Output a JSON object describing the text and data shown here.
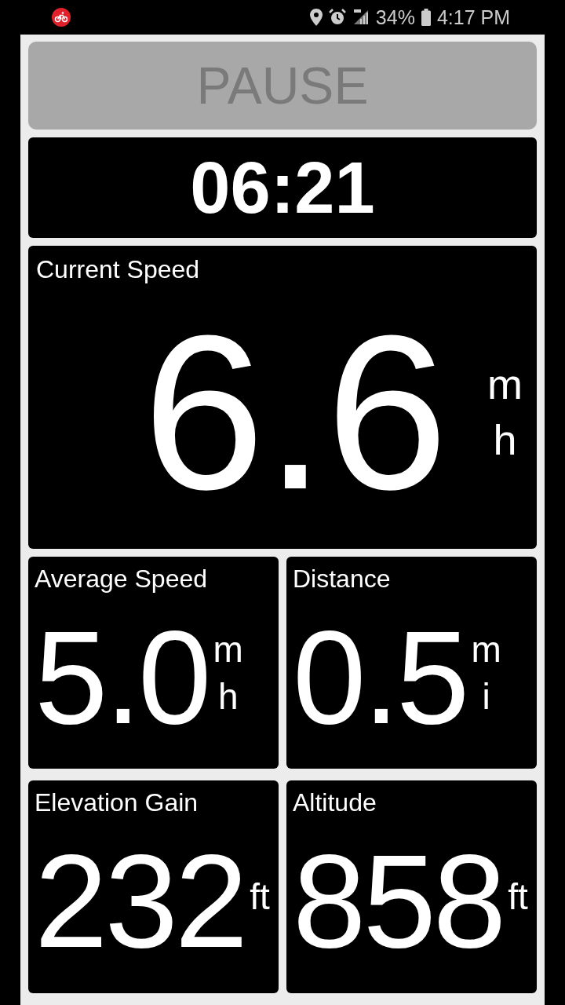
{
  "status_bar": {
    "battery": "34%",
    "time": "4:17 PM"
  },
  "pause_button": {
    "label": "PAUSE"
  },
  "timer": "06:21",
  "current_speed": {
    "label": "Current Speed",
    "value": "6.6",
    "unit_lines": [
      "m",
      "h"
    ]
  },
  "tiles": [
    {
      "label": "Average Speed",
      "value": "5.0",
      "unit_lines": [
        "m",
        "h"
      ]
    },
    {
      "label": "Distance",
      "value": "0.5",
      "unit_lines": [
        "m",
        "i"
      ]
    },
    {
      "label": "Elevation Gain",
      "value": "232",
      "unit_lines": [
        "ft"
      ]
    },
    {
      "label": "Altitude",
      "value": "858",
      "unit_lines": [
        "ft"
      ]
    }
  ]
}
